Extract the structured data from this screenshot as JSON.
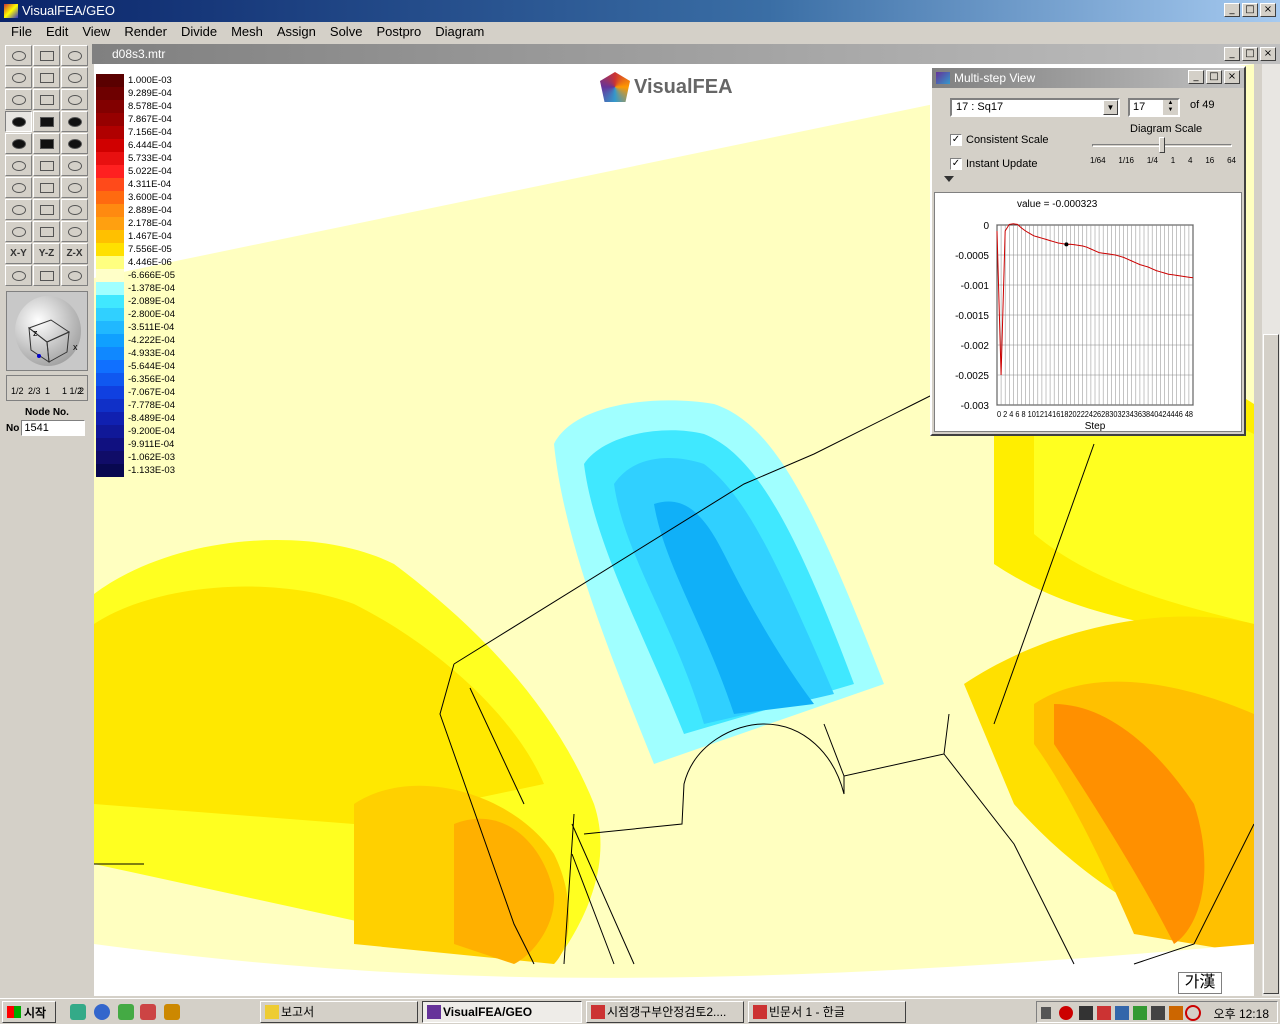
{
  "app": {
    "title": "VisualFEA/GEO"
  },
  "menu": [
    "File",
    "Edit",
    "View",
    "Render",
    "Divide",
    "Mesh",
    "Assign",
    "Solve",
    "Postpro",
    "Diagram"
  ],
  "toolbox": {
    "buttons": [
      "line",
      "arc",
      "arc2",
      "curve",
      "rect",
      "surf",
      "sphere",
      "cone",
      "torus",
      "select",
      "select-node",
      "select-elem",
      "pick1",
      "pick2",
      "pick3",
      "wave",
      "shape",
      "layer",
      "move",
      "rotate",
      "zoom",
      "box1",
      "box2",
      "box3",
      "rot-view",
      "pan",
      "fit",
      "x-y",
      "y-z",
      "z-x",
      "shade",
      "move4",
      "center"
    ],
    "view_labels": {
      "xy": "X-Y",
      "yz": "Y-Z",
      "zx": "Z-X"
    },
    "scale_labels": [
      "1/2",
      "2/3",
      "1",
      "1 1/2",
      "2"
    ],
    "node_label": "Node No.",
    "node_prefix": "No",
    "node_value": "1541"
  },
  "document": {
    "title": "d08s3.mtr",
    "logo": "VisualFEA"
  },
  "legend": {
    "labels": [
      "1.000E-03",
      "9.289E-04",
      "8.578E-04",
      "7.867E-04",
      "7.156E-04",
      "6.444E-04",
      "5.733E-04",
      "5.022E-04",
      "4.311E-04",
      "3.600E-04",
      "2.889E-04",
      "2.178E-04",
      "1.467E-04",
      "7.556E-05",
      "4.446E-06",
      "-6.666E-05",
      "-1.378E-04",
      "-2.089E-04",
      "-2.800E-04",
      "-3.511E-04",
      "-4.222E-04",
      "-4.933E-04",
      "-5.644E-04",
      "-6.356E-04",
      "-7.067E-04",
      "-7.778E-04",
      "-8.489E-04",
      "-9.200E-04",
      "-9.911E-04",
      "-1.062E-03",
      "-1.133E-03"
    ],
    "colors": [
      "#5a0000",
      "#6e0000",
      "#820000",
      "#960000",
      "#b00000",
      "#d00000",
      "#e81010",
      "#ff2020",
      "#ff4a1a",
      "#ff6a10",
      "#ff8a10",
      "#ffa010",
      "#ffc000",
      "#ffe000",
      "#ffff80",
      "#ffffc8",
      "#a0ffff",
      "#40e8ff",
      "#30d0ff",
      "#20b8ff",
      "#10a0ff",
      "#1088ff",
      "#1070ff",
      "#1058f0",
      "#1040e0",
      "#1030c8",
      "#1020b0",
      "#101898",
      "#101080",
      "#100c68",
      "#080850"
    ]
  },
  "multistep": {
    "title": "Multi-step View",
    "step_select": "17 : Sq17",
    "step_value": "17",
    "of_label": "of 49",
    "consistent_scale": "Consistent Scale",
    "instant_update": "Instant Update",
    "diagram_scale_label": "Diagram Scale",
    "scale_ticks": [
      "1/64",
      "1/16",
      "1/4",
      "1",
      "4",
      "16",
      "64"
    ],
    "chart_data": {
      "type": "line",
      "title": "value = -0.000323",
      "xlabel": "Step",
      "ylabel": "",
      "xlim": [
        0,
        48
      ],
      "ylim": [
        -0.003,
        0
      ],
      "yticks": [
        "0",
        "-0.0005",
        "-0.001",
        "-0.0015",
        "-0.002",
        "-0.0025",
        "-0.003"
      ],
      "xtick_text": "0 2 4 6 8 10121416182022242628303234363840424446 48",
      "x": [
        0,
        1,
        2,
        3,
        4,
        5,
        6,
        7,
        8,
        9,
        10,
        11,
        12,
        13,
        14,
        15,
        16,
        17,
        18,
        19,
        20,
        21,
        22,
        23,
        24,
        25,
        26,
        27,
        28,
        29,
        30,
        31,
        32,
        33,
        34,
        35,
        36,
        37,
        38,
        39,
        40,
        41,
        42,
        43,
        44,
        45,
        46,
        47,
        48
      ],
      "values": [
        -0.0001,
        -0.0025,
        -0.0001,
        1e-05,
        2e-05,
        1e-05,
        -5e-05,
        -0.0001,
        -0.00014,
        -0.00018,
        -0.0002,
        -0.00022,
        -0.00024,
        -0.00026,
        -0.00028,
        -0.0003,
        -0.00031,
        -0.000323,
        -0.00032,
        -0.00033,
        -0.00034,
        -0.00035,
        -0.00037,
        -0.0004,
        -0.00043,
        -0.00046,
        -0.00047,
        -0.00048,
        -0.00049,
        -0.0005,
        -0.00052,
        -0.00054,
        -0.00057,
        -0.0006,
        -0.00063,
        -0.00066,
        -0.00068,
        -0.0007,
        -0.00073,
        -0.00076,
        -0.00078,
        -0.0008,
        -0.00082,
        -0.00083,
        -0.00084,
        -0.00085,
        -0.00086,
        -0.00087,
        -0.00088
      ],
      "marker_step": 17,
      "line_color": "#cc0000"
    }
  },
  "ime": "가漢",
  "taskbar": {
    "start": "시작",
    "tasks": [
      "보고서",
      "VisualFEA/GEO",
      "시점갱구부안정검토2....",
      "빈문서 1 - 한글"
    ],
    "clock": "오후 12:18"
  }
}
